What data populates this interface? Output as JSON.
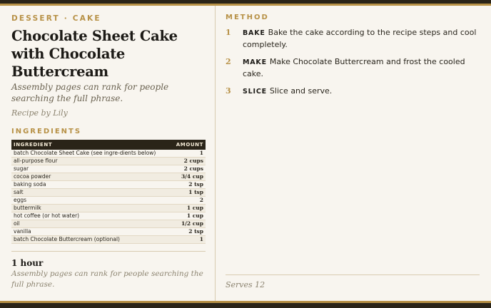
{
  "card": {
    "kicker": "DESSERT · CAKE",
    "title": "Chocolate Sheet Cake with Chocolate Buttercream",
    "subtitle": "Assembly pages can rank for people searching the full phrase.",
    "author": "Recipe by Lily"
  },
  "ingredients": {
    "label": "INGREDIENTS",
    "headers": {
      "ingredient": "INGREDIENT",
      "amount": "AMOUNT"
    },
    "rows": [
      {
        "name": "batch Chocolate Sheet Cake (see ingre-dients below)",
        "amount": "1"
      },
      {
        "name": "all-purpose flour",
        "amount": "2 cups"
      },
      {
        "name": "sugar",
        "amount": "2 cups"
      },
      {
        "name": "cocoa powder",
        "amount": "3/4 cup"
      },
      {
        "name": "baking soda",
        "amount": "2 tsp"
      },
      {
        "name": "salt",
        "amount": "1 tsp"
      },
      {
        "name": "eggs",
        "amount": "2"
      },
      {
        "name": "buttermilk",
        "amount": "1 cup"
      },
      {
        "name": "hot coffee (or hot water)",
        "amount": "1 cup"
      },
      {
        "name": "oil",
        "amount": "1/2 cup"
      },
      {
        "name": "vanilla",
        "amount": "2 tsp"
      },
      {
        "name": "batch Chocolate Buttercream (optional)",
        "amount": "1"
      }
    ]
  },
  "time": {
    "value": "1 hour",
    "note": "Assembly pages can rank for people searching the full phrase."
  },
  "method": {
    "label": "METHOD",
    "steps": [
      {
        "num": "1",
        "verb": "BAKE",
        "text": "Bake the cake according to the recipe steps and cool completely."
      },
      {
        "num": "2",
        "verb": "MAKE",
        "text": "Make Chocolate Buttercream and frost the cooled cake."
      },
      {
        "num": "3",
        "verb": "SLICE",
        "text": "Slice and serve."
      }
    ]
  },
  "serves": "Serves 12",
  "colors": {
    "accent": "#b79146",
    "dark": "#2a2418",
    "paper": "#f8f5ef"
  }
}
